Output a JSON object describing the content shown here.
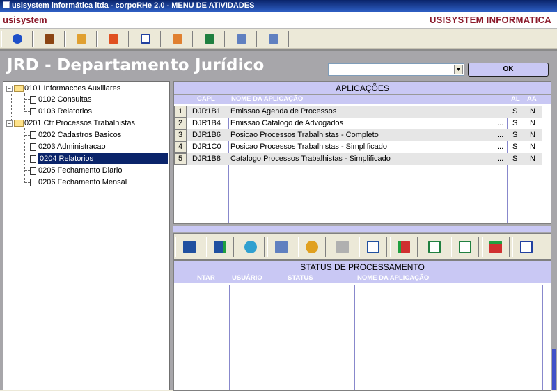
{
  "window": {
    "title": "usisystem informática ltda - corpoRHe 2.0 - MENU DE ATIVIDADES"
  },
  "appbar": {
    "left_label": "usisystem",
    "right_label": "USISYSTEM INFORMATICA"
  },
  "toolbar": {
    "icons": [
      "back-icon",
      "users-icon",
      "hand-icon",
      "exit-icon",
      "report-icon",
      "book-icon",
      "book-green-icon",
      "calculator-icon",
      "calculator-2-icon"
    ]
  },
  "page": {
    "title": "JRD - Departamento Jurídico",
    "combo_value": "",
    "ok_label": "OK"
  },
  "tree": {
    "nodes": [
      {
        "label": "0101 Informacoes Auxiliares",
        "level": 0,
        "type": "folder",
        "expander": "−"
      },
      {
        "label": "0102 Consultas",
        "level": 1,
        "type": "doc"
      },
      {
        "label": "0103 Relatorios",
        "level": 1,
        "type": "doc"
      },
      {
        "label": "0201 Ctr Processos Trabalhistas",
        "level": 0,
        "type": "folder",
        "expander": "−"
      },
      {
        "label": "0202 Cadastros Basicos",
        "level": 1,
        "type": "doc"
      },
      {
        "label": "0203 Administracao",
        "level": 1,
        "type": "doc"
      },
      {
        "label": "0204 Relatorios",
        "level": 1,
        "type": "doc",
        "selected": true
      },
      {
        "label": "0205 Fechamento Diario",
        "level": 1,
        "type": "doc"
      },
      {
        "label": "0206 Fechamento Mensal",
        "level": 1,
        "type": "doc"
      }
    ]
  },
  "apps": {
    "title": "APLICAÇÕES",
    "columns": {
      "capl": "CAPL",
      "nome": "NOME DA APLICAÇÃO",
      "al": "AL",
      "aa": "AA"
    },
    "rows": [
      {
        "n": "1",
        "capl": "DJR1B1",
        "nome": "Emissao Agenda de Processos",
        "dots": "",
        "al": "S",
        "aa": "N"
      },
      {
        "n": "2",
        "capl": "DJR1B4",
        "nome": "Emissao Catalogo de Advogados",
        "dots": "...",
        "al": "S",
        "aa": "N"
      },
      {
        "n": "3",
        "capl": "DJR1B6",
        "nome": "Posicao Processos Trabalhistas - Completo",
        "dots": "...",
        "al": "S",
        "aa": "N"
      },
      {
        "n": "4",
        "capl": "DJR1C0",
        "nome": "Posicao Processos Trabalhistas - Simplificado",
        "dots": "...",
        "al": "S",
        "aa": "N"
      },
      {
        "n": "5",
        "capl": "DJR1B8",
        "nome": "Catalogo Processos Trabalhistas - Simplificado",
        "dots": "...",
        "al": "S",
        "aa": "N"
      }
    ]
  },
  "actions": {
    "icons": [
      "tree-icon",
      "tree-add-icon",
      "refresh-icon",
      "calculator-icon",
      "disk-icon",
      "printer-icon",
      "upload-icon",
      "eraser-icon",
      "page-next-icon",
      "page-refresh-icon",
      "export-icon",
      "word-icon"
    ]
  },
  "status": {
    "title": "STATUS DE PROCESSAMENTO",
    "columns": {
      "ntar": "NTAR",
      "usuario": "USUÁRIO",
      "status": "STATUS",
      "nome": "NOME DA APLICAÇÃO"
    }
  },
  "colors": {
    "header_blue": "#C9C8F4",
    "brand_red": "#8B1A2B",
    "title_blue": "#0A246A",
    "bg_gray": "#A7A6AA"
  }
}
